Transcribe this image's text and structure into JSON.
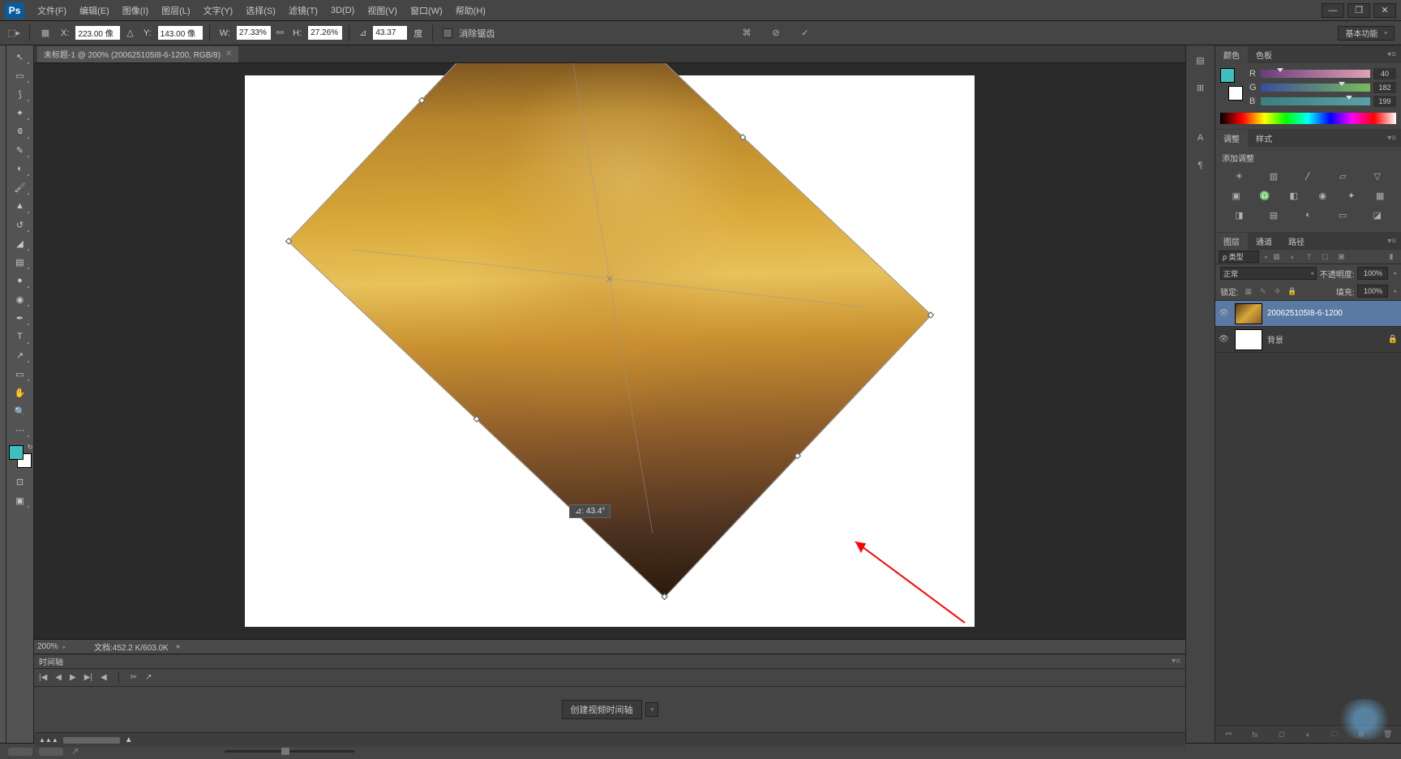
{
  "menubar": {
    "logo": "Ps",
    "items": [
      "文件(F)",
      "编辑(E)",
      "图像(I)",
      "图层(L)",
      "文字(Y)",
      "选择(S)",
      "滤镜(T)",
      "3D(D)",
      "视图(V)",
      "窗口(W)",
      "帮助(H)"
    ]
  },
  "window_controls": {
    "min": "—",
    "restore": "❐",
    "close": "✕"
  },
  "options": {
    "x_label": "X:",
    "x_value": "223.00 像",
    "y_label": "Y:",
    "y_value": "143.00 像",
    "w_label": "W:",
    "w_value": "27.33%",
    "h_label": "H:",
    "h_value": "27.26%",
    "angle_value": "43.37",
    "angle_unit": "度",
    "antialias": "消除锯齿",
    "workspace": "基本功能"
  },
  "document": {
    "tab_title": "未标题-1 @ 200% (200625105I8-6-1200, RGB/8)",
    "tooltip": "⊿: 43.4°",
    "zoom": "200%",
    "doc_info": "文档:452.2 K/603.0K"
  },
  "timeline": {
    "title": "时间轴",
    "create_btn": "创建视频时间轴"
  },
  "color_panel": {
    "tabs": [
      "颜色",
      "色板"
    ],
    "r": {
      "label": "R",
      "value": "40"
    },
    "g": {
      "label": "G",
      "value": "182"
    },
    "b": {
      "label": "B",
      "value": "199"
    }
  },
  "adjustments": {
    "tabs": [
      "调整",
      "样式"
    ],
    "label": "添加调整"
  },
  "layers": {
    "tabs": [
      "图层",
      "通道",
      "路径"
    ],
    "filter_type": "ρ 类型",
    "blend_mode": "正常",
    "opacity_label": "不透明度:",
    "opacity_value": "100%",
    "lock_label": "锁定:",
    "fill_label": "填充:",
    "fill_value": "100%",
    "items": [
      {
        "name": "200625105I8-6-1200",
        "locked": false,
        "selected": true,
        "thumb": "leaf"
      },
      {
        "name": "背景",
        "locked": true,
        "selected": false,
        "thumb": "white"
      }
    ]
  }
}
